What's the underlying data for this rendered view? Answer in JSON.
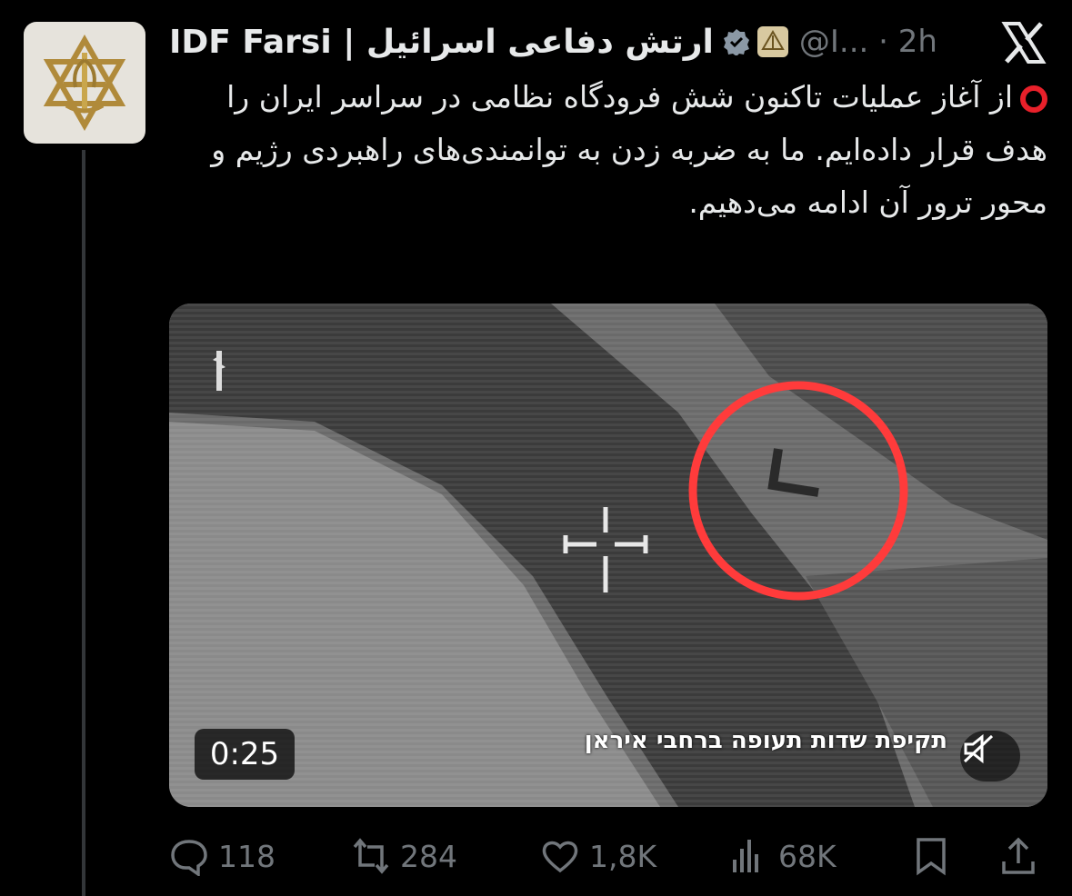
{
  "post": {
    "display_name": "IDF Farsi | ارتش دفاعی اسرائیل",
    "handle_time": "@I... · 2h",
    "text": "از آغاز عملیات تاکنون شش فرودگاه نظامی در سراسر ایران را هدف قرار داده‌ایم. ما به ضربه زدن به توانمندی‌های راهبردی رژیم و محور ترور آن ادامه می‌دهیم."
  },
  "media": {
    "duration": "0:25",
    "caption": "תקיפת שדות תעופה ברחבי איראן"
  },
  "actions": {
    "replies": "118",
    "reposts": "284",
    "likes": "1,8K",
    "views": "68K"
  },
  "colors": {
    "background": "#000000",
    "text": "#e7e9ea",
    "muted": "#71767b",
    "verified": "#8b98a5",
    "red_marker": "#e8202a"
  },
  "icons": [
    "idf-logo-icon",
    "verified-badge-icon",
    "emoji-badge-icon",
    "x-logo-icon",
    "red-circle-icon",
    "mute-icon",
    "reply-icon",
    "repost-icon",
    "like-icon",
    "views-icon",
    "bookmark-icon",
    "share-icon"
  ]
}
